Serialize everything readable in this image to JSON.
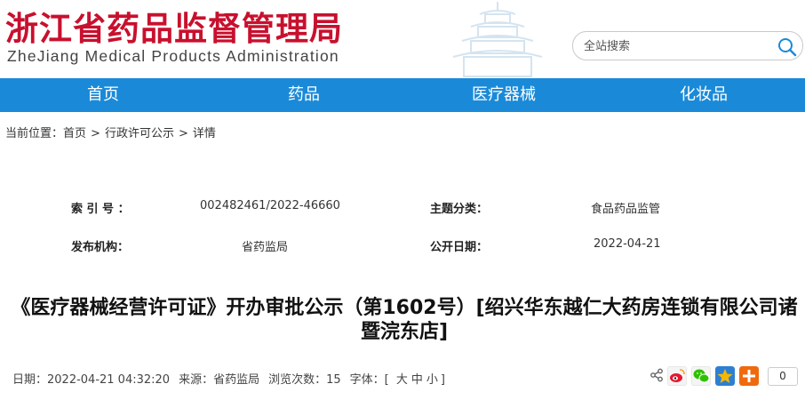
{
  "header": {
    "logo_cn": "浙江省药品监督管理局",
    "logo_en": "ZheJiang Medical Products Administration",
    "search_placeholder": "全站搜索"
  },
  "nav": {
    "items": [
      "首页",
      "药品",
      "医疗器械",
      "化妆品"
    ],
    "bg_color": "#1a8ad8"
  },
  "breadcrumb": {
    "prefix": "当前位置：",
    "items": [
      "首页",
      "行政许可公示",
      "详情"
    ],
    "separator": ">"
  },
  "meta": {
    "index_label": "索 引 号 ：",
    "index_value": "002482461/2022-46660",
    "topic_label": "主题分类：",
    "topic_value": "食品药品监管",
    "publisher_label": "发布机构：",
    "publisher_value": "省药监局",
    "date_label": "公开日期：",
    "date_value": "2022-04-21"
  },
  "article": {
    "title": "《医疗器械经营许可证》开办审批公示（第1602号）[绍兴华东越仁大药房连锁有限公司诸暨浣东店]"
  },
  "info": {
    "date": "日期：2022-04-21 04:32:20",
    "source": "来源：省药监局",
    "views": "浏览次数：15",
    "font_label": "字体：[",
    "font_large": "大",
    "font_medium": "中",
    "font_small": "小",
    "font_close": "]"
  },
  "share": {
    "count": "0",
    "icons": [
      "weibo-icon",
      "wechat-icon",
      "qzone-icon",
      "more-share-icon"
    ],
    "colors": {
      "weibo": "#e6162d",
      "wechat": "#2dc100",
      "qzone": "#f5b700",
      "more": "#ef6a0e"
    }
  },
  "colors": {
    "brand_red": "#c8102e",
    "nav_blue": "#1a8ad8"
  }
}
